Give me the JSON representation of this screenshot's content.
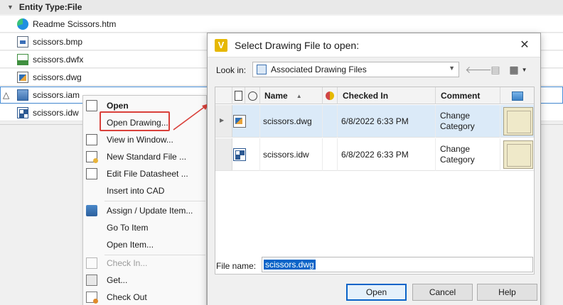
{
  "group": {
    "label": "Entity Type:File"
  },
  "files": [
    {
      "name": "Readme Scissors.htm",
      "icon": "edge-browser-icon"
    },
    {
      "name": "scissors.bmp",
      "icon": "bitmap-file-icon"
    },
    {
      "name": "scissors.dwfx",
      "icon": "dwfx-file-icon"
    },
    {
      "name": "scissors.dwg",
      "icon": "dwg-file-icon"
    },
    {
      "name": "scissors.iam",
      "icon": "assembly-file-icon",
      "status": "△"
    },
    {
      "name": "scissors.idw",
      "icon": "drawing-file-icon"
    }
  ],
  "context_menu": {
    "items": [
      {
        "label": "Open",
        "bold": true,
        "icon": "folder-open-icon"
      },
      {
        "label": "Open Drawing..."
      },
      {
        "label": "View in Window...",
        "icon": "window-icon"
      },
      {
        "label": "New Standard File ...",
        "icon": "new-file-icon"
      },
      {
        "label": "Edit File Datasheet ...",
        "icon": "datasheet-icon"
      },
      {
        "label": "Insert into CAD"
      },
      {
        "label": "Assign / Update Item...",
        "icon": "assign-item-icon"
      },
      {
        "label": "Go To Item"
      },
      {
        "label": "Open Item..."
      },
      {
        "label": "Check In...",
        "disabled": true,
        "icon": "check-in-icon"
      },
      {
        "label": "Get...",
        "icon": "get-icon"
      },
      {
        "label": "Check Out",
        "icon": "check-out-icon"
      }
    ]
  },
  "dialog": {
    "title": "Select Drawing File to open:",
    "close_glyph": "✕",
    "look_in_label": "Look in:",
    "look_in_value": "Associated Drawing Files",
    "columns": {
      "name": "Name",
      "checked_in": "Checked In",
      "comment": "Comment"
    },
    "rows": [
      {
        "name": "scissors.dwg",
        "checked_in": "6/8/2022 6:33 PM",
        "comment_line1": "Change",
        "comment_line2": "Category",
        "icon": "dwg-file-icon"
      },
      {
        "name": "scissors.idw",
        "checked_in": "6/8/2022 6:33 PM",
        "comment_line1": "Change",
        "comment_line2": "Category",
        "icon": "drawing-file-icon"
      }
    ],
    "file_name_label": "File name:",
    "file_name_value": "scissors.dwg",
    "buttons": {
      "open": "Open",
      "cancel": "Cancel",
      "help": "Help"
    }
  },
  "colors": {
    "highlight_box": "#d9403a",
    "selection": "#0a64c8",
    "selected_row": "#dbeaf8"
  }
}
